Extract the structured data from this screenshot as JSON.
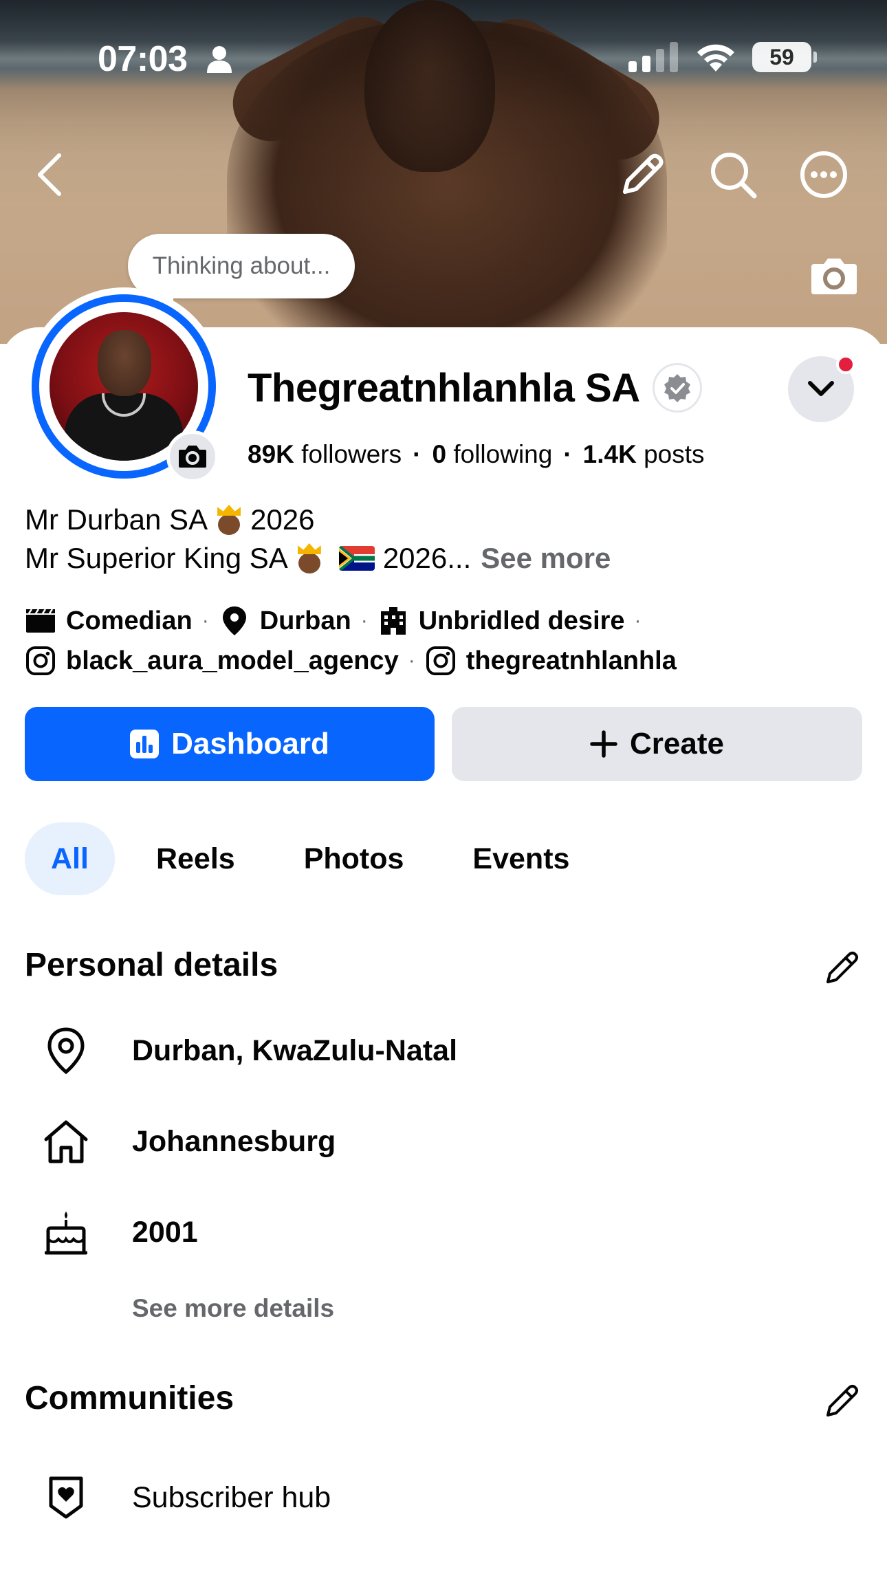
{
  "status_bar": {
    "time": "07:03",
    "battery": "59"
  },
  "thinking_bubble": {
    "placeholder": "Thinking about..."
  },
  "profile": {
    "name": "Thegreatnhlanhla SA",
    "followers_count": "89K",
    "followers_label": "followers",
    "following_count": "0",
    "following_label": "following",
    "posts_count": "1.4K",
    "posts_label": "posts",
    "separator": "·"
  },
  "bio": {
    "line1_start": "Mr Durban SA",
    "line1_end": "2026",
    "line2_start": "Mr Superior King SA",
    "line2_end": "2026...",
    "see_more": "See more"
  },
  "meta": {
    "category": "Comedian",
    "location": "Durban",
    "work": "Unbridled desire",
    "instagram_1": "black_aura_model_agency",
    "instagram_2": "thegreatnhlanhla",
    "dot": "·"
  },
  "actions": {
    "dashboard_label": "Dashboard",
    "create_label": "Create"
  },
  "tabs": [
    {
      "label": "All",
      "active": true
    },
    {
      "label": "Reels",
      "active": false
    },
    {
      "label": "Photos",
      "active": false
    },
    {
      "label": "Events",
      "active": false
    }
  ],
  "personal_details": {
    "title": "Personal details",
    "items": [
      {
        "icon": "location-pin-icon",
        "text": "Durban, KwaZulu-Natal"
      },
      {
        "icon": "home-icon",
        "text": "Johannesburg"
      },
      {
        "icon": "birthday-cake-icon",
        "text": "2001"
      }
    ],
    "see_more_details": "See more details"
  },
  "communities": {
    "title": "Communities",
    "items": [
      {
        "icon": "heart-shield-icon",
        "text": "Subscriber hub"
      }
    ]
  },
  "colors": {
    "accent": "#0866ff",
    "notification": "#e41e3f",
    "secondary_text": "#65676b",
    "button_gray": "#e4e6eb"
  }
}
